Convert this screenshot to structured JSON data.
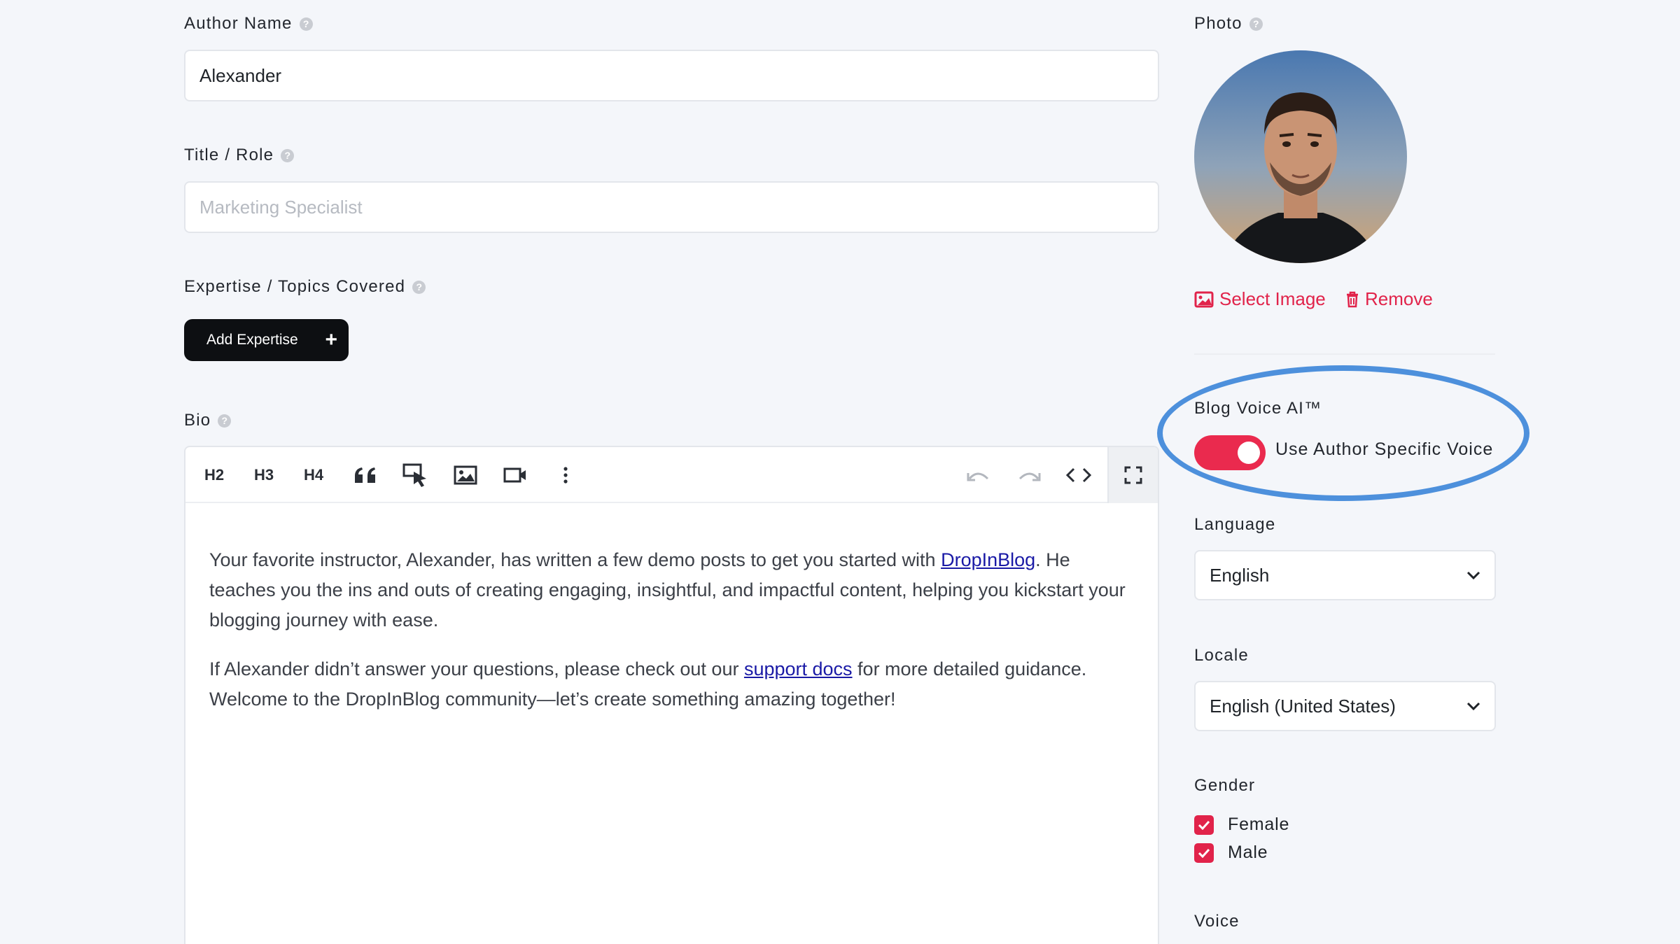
{
  "fields": {
    "author_name": {
      "label": "Author Name",
      "value": "Alexander"
    },
    "title_role": {
      "label": "Title / Role",
      "placeholder": "Marketing Specialist"
    },
    "expertise": {
      "label": "Expertise / Topics Covered",
      "button_label": "Add Expertise",
      "button_icon": "+"
    },
    "bio": {
      "label": "Bio"
    }
  },
  "editor": {
    "toolbar": {
      "h2": "H2",
      "h3": "H3",
      "h4": "H4"
    },
    "paragraph1": {
      "before": "Your favorite instructor, Alexander, has written a few demo posts to get you started with ",
      "link": "DropInBlog",
      "after": ". He teaches you the ins and outs of creating engaging, insightful, and impactful content, helping you kickstart your blogging journey with ease."
    },
    "paragraph2": {
      "before": "If Alexander didn’t answer your questions, please check out our ",
      "link": "support docs",
      "after": " for more detailed guidance. Welcome to the DropInBlog community—let’s create something amazing together!"
    }
  },
  "photo": {
    "label": "Photo",
    "select_label": "Select Image",
    "remove_label": "Remove"
  },
  "blog_voice": {
    "label": "Blog Voice AI™",
    "toggle_label": "Use Author Specific Voice",
    "enabled": true
  },
  "language": {
    "label": "Language",
    "value": "English"
  },
  "locale": {
    "label": "Locale",
    "value": "English (United States)"
  },
  "gender": {
    "label": "Gender",
    "options": [
      {
        "label": "Female",
        "checked": true
      },
      {
        "label": "Male",
        "checked": true
      }
    ]
  },
  "voice": {
    "label": "Voice"
  },
  "colors": {
    "accent": "#e1234a",
    "toggle": "#ea2a4e",
    "highlight": "#4d90dc",
    "link": "#1a1aa6"
  },
  "icons": [
    "help-icon",
    "plus-icon",
    "quote-icon",
    "cursor-select-icon",
    "image-icon",
    "video-icon",
    "more-vertical-icon",
    "undo-icon",
    "redo-icon",
    "code-icon",
    "fullscreen-icon",
    "select-image-icon",
    "trash-icon",
    "chevron-down-icon",
    "check-icon"
  ]
}
